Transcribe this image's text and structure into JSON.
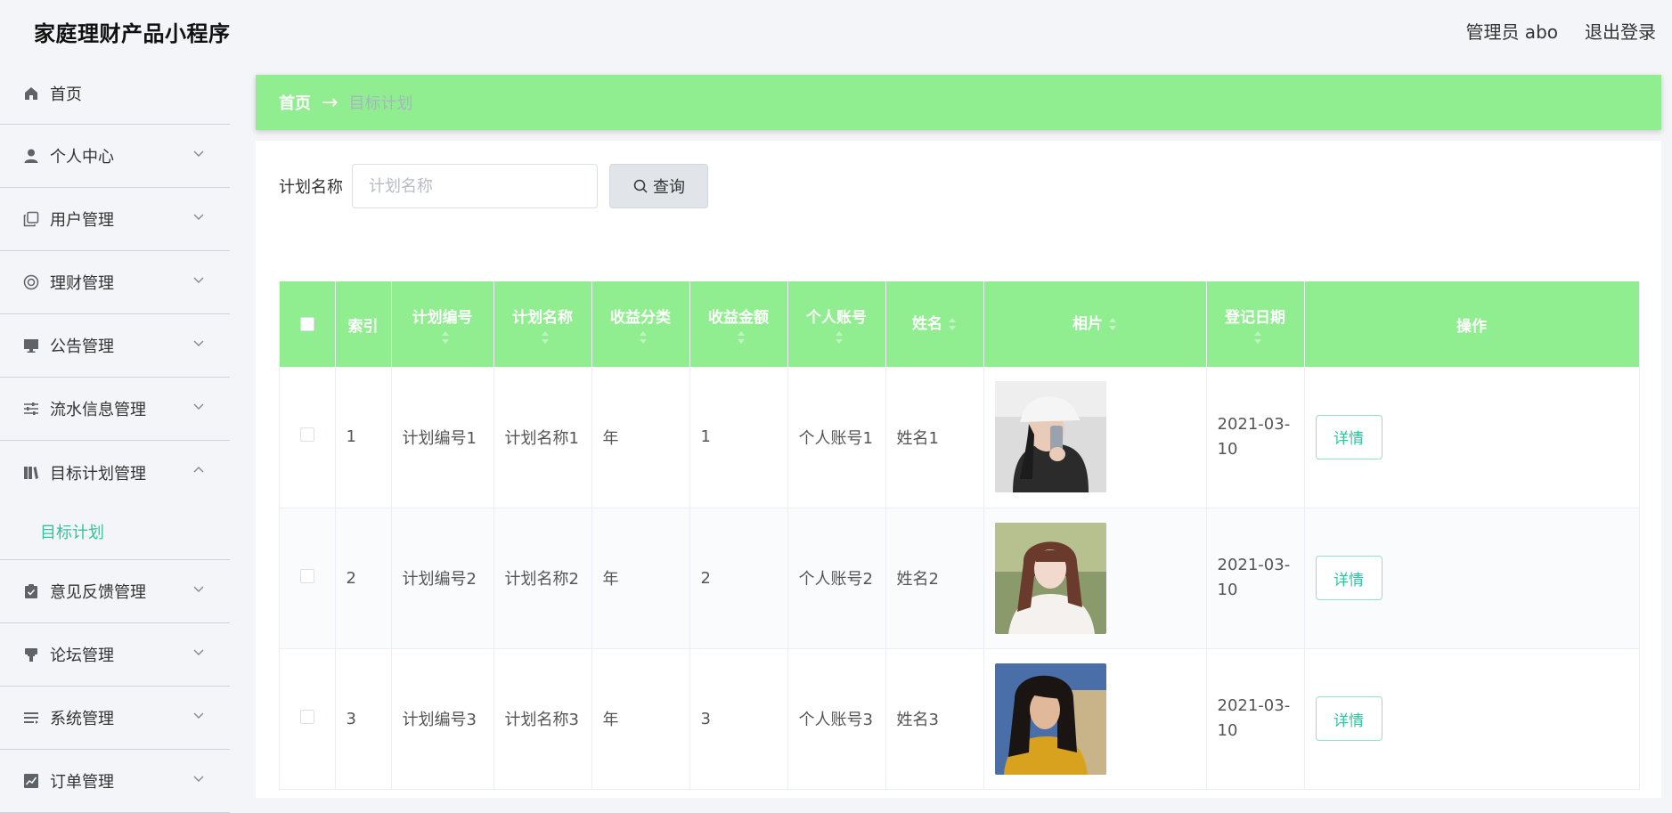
{
  "app": {
    "title": "家庭理财产品小程序"
  },
  "header": {
    "user_label": "管理员 abo",
    "logout_label": "退出登录"
  },
  "sidebar": {
    "items": [
      {
        "label": "首页",
        "icon": "home-icon"
      },
      {
        "label": "个人中心",
        "icon": "user-icon"
      },
      {
        "label": "用户管理",
        "icon": "copy-icon"
      },
      {
        "label": "理财管理",
        "icon": "lifebuoy-icon"
      },
      {
        "label": "公告管理",
        "icon": "monitor-icon"
      },
      {
        "label": "流水信息管理",
        "icon": "sliders-icon"
      },
      {
        "label": "目标计划管理",
        "icon": "books-icon",
        "expanded": true,
        "children": [
          {
            "label": "目标计划",
            "active": true
          }
        ]
      },
      {
        "label": "意见反馈管理",
        "icon": "clipboard-check-icon"
      },
      {
        "label": "论坛管理",
        "icon": "brush-icon"
      },
      {
        "label": "系统管理",
        "icon": "list-icon"
      },
      {
        "label": "订单管理",
        "icon": "chart-icon"
      }
    ]
  },
  "breadcrumb": {
    "home": "首页",
    "separator": "→",
    "current": "目标计划"
  },
  "search": {
    "label": "计划名称",
    "placeholder": "计划名称",
    "value": "",
    "button_label": "查询"
  },
  "table": {
    "columns": [
      "索引",
      "计划编号",
      "计划名称",
      "收益分类",
      "收益金额",
      "个人账号",
      "姓名",
      "相片",
      "登记日期",
      "操作"
    ],
    "rows": [
      {
        "index": "1",
        "plan_no": "计划编号1",
        "plan_name": "计划名称1",
        "category": "年",
        "amount": "1",
        "account": "个人账号1",
        "name": "姓名1",
        "photo": "photo-woman-white-cap",
        "date": "2021-03-10",
        "action": "详情"
      },
      {
        "index": "2",
        "plan_no": "计划编号2",
        "plan_name": "计划名称2",
        "category": "年",
        "amount": "2",
        "account": "个人账号2",
        "name": "姓名2",
        "photo": "photo-woman-braids",
        "date": "2021-03-10",
        "action": "详情"
      },
      {
        "index": "3",
        "plan_no": "计划编号3",
        "plan_name": "计划名称3",
        "category": "年",
        "amount": "3",
        "account": "个人账号3",
        "name": "姓名3",
        "photo": "photo-woman-yellow-jacket",
        "date": "2021-03-10",
        "action": "详情"
      }
    ]
  },
  "colors": {
    "accent_green": "#90ee90",
    "link_teal": "#2fc5a0"
  }
}
